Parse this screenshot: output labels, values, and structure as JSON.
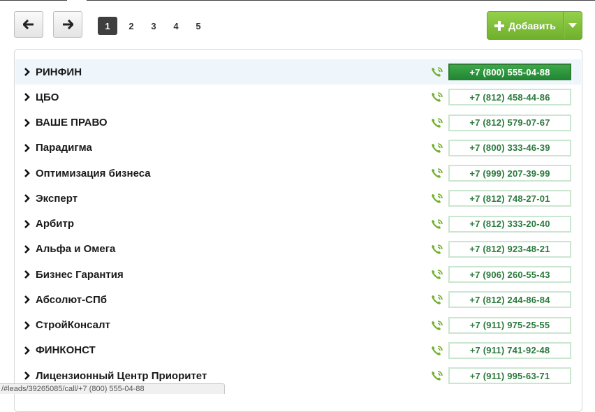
{
  "toolbar": {
    "prev_icon": "arrow-left-icon",
    "next_icon": "arrow-right-icon",
    "pages": [
      "1",
      "2",
      "3",
      "4",
      "5"
    ],
    "active_page": "1",
    "add_label": "Добавить",
    "add_icon": "plus-icon",
    "dropdown_icon": "caret-down-icon",
    "add_color": "#7cbf36"
  },
  "list": {
    "row_icon": "chevron-right-icon",
    "call_icon": "phone-call-icon",
    "highlight_color": "#eef5fb",
    "phone_color": "#2b7a3c",
    "items": [
      {
        "name": "РИНФИН",
        "phone": "+7 (800) 555-04-88",
        "active": true
      },
      {
        "name": "ЦБО",
        "phone": "+7 (812) 458-44-86",
        "active": false
      },
      {
        "name": "ВАШЕ ПРАВО",
        "phone": "+7 (812) 579-07-67",
        "active": false
      },
      {
        "name": "Парадигма",
        "phone": "+7 (800) 333-46-39",
        "active": false
      },
      {
        "name": "Оптимизация бизнеса",
        "phone": "+7 (999) 207-39-99",
        "active": false
      },
      {
        "name": "Эксперт",
        "phone": "+7 (812) 748-27-01",
        "active": false
      },
      {
        "name": "Арбитр",
        "phone": "+7 (812) 333-20-40",
        "active": false
      },
      {
        "name": "Альфа и Омега",
        "phone": "+7 (812) 923-48-21",
        "active": false
      },
      {
        "name": "Бизнес Гарантия",
        "phone": "+7 (906) 260-55-43",
        "active": false
      },
      {
        "name": "Абсолют-СПб",
        "phone": "+7 (812) 244-86-84",
        "active": false
      },
      {
        "name": "СтройКонсалт",
        "phone": "+7 (911) 975-25-55",
        "active": false
      },
      {
        "name": "ФИНКОНСТ",
        "phone": "+7 (911) 741-92-48",
        "active": false
      },
      {
        "name": "Лицензионный Центр Приоритет",
        "phone": "+7 (911) 995-63-71",
        "active": false
      }
    ]
  },
  "status_bar": {
    "url": "/#leads/39265085/call/+7 (800) 555-04-88"
  }
}
